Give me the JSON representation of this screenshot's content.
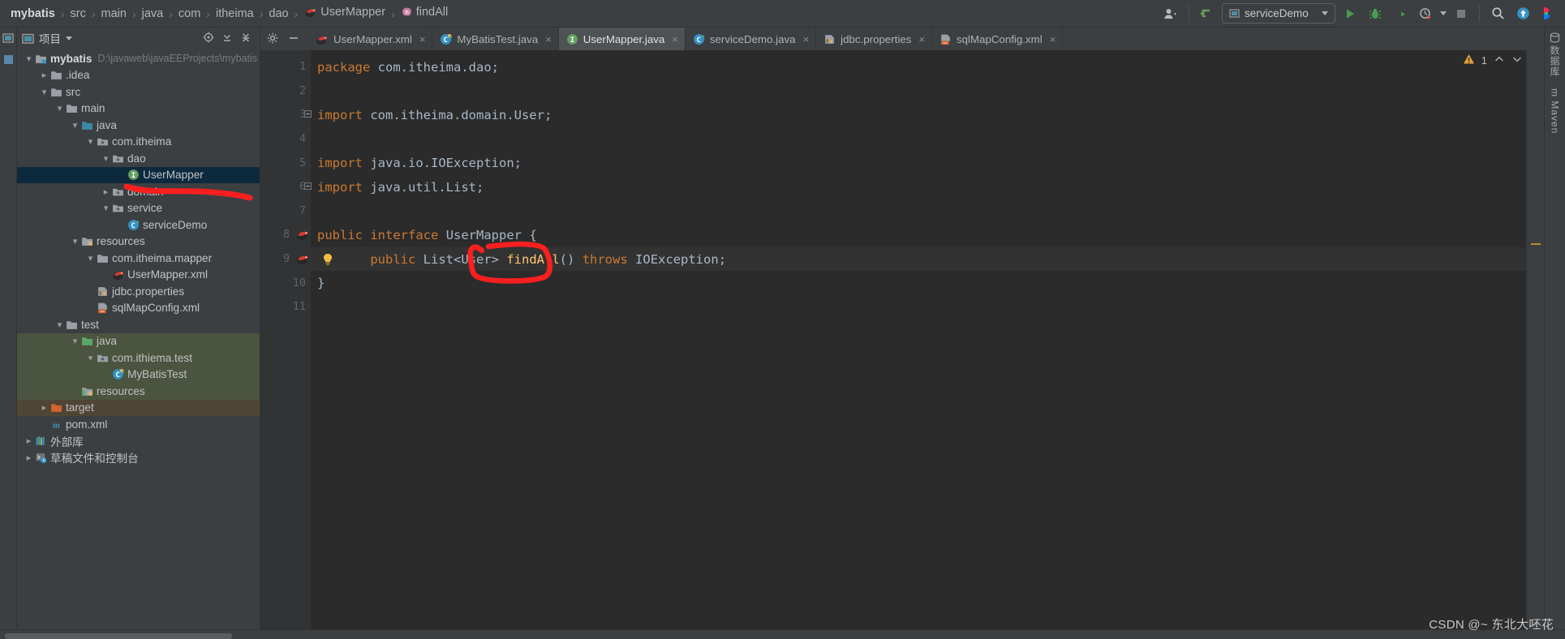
{
  "breadcrumb": {
    "items": [
      {
        "label": "mybatis",
        "icon": "none",
        "bold": true
      },
      {
        "label": "src",
        "icon": "none",
        "bold": false
      },
      {
        "label": "main",
        "icon": "none",
        "bold": false
      },
      {
        "label": "java",
        "icon": "none",
        "bold": false
      },
      {
        "label": "com",
        "icon": "none",
        "bold": false
      },
      {
        "label": "itheima",
        "icon": "none",
        "bold": false
      },
      {
        "label": "dao",
        "icon": "none",
        "bold": false
      },
      {
        "label": "UserMapper",
        "icon": "mybatis-icon",
        "bold": false
      },
      {
        "label": "findAll",
        "icon": "method-icon",
        "bold": false
      }
    ],
    "separator": "›"
  },
  "toolbar": {
    "user_icon": "user-account-icon",
    "update_icon": "update-project-icon",
    "run_config": "serviceDemo",
    "run_label": "run-icon",
    "debug_label": "debug-icon",
    "run_coverage_label": "run-with-coverage-icon",
    "profiler_label": "profiler-icon",
    "stop_label": "stop-icon",
    "search_label": "search-everywhere-icon",
    "updates_label": "updates-icon",
    "ide_label": "ide-icon"
  },
  "project_panel": {
    "title": "项目",
    "header_icons": [
      "locate-icon",
      "expand-all-icon",
      "collapse-all-icon",
      "settings-icon",
      "hide-icon"
    ],
    "tree": [
      {
        "depth": 0,
        "arrow": "open",
        "icon": "module-icon",
        "label": "mybatis",
        "bold": true,
        "path": "D:\\javaweb\\javaEEProjects\\mybatis",
        "state": "normal"
      },
      {
        "depth": 1,
        "arrow": "closed",
        "icon": "folder-icon",
        "label": ".idea",
        "bold": false,
        "path": "",
        "state": "normal"
      },
      {
        "depth": 1,
        "arrow": "open",
        "icon": "folder-icon",
        "label": "src",
        "bold": false,
        "path": "",
        "state": "normal"
      },
      {
        "depth": 2,
        "arrow": "open",
        "icon": "folder-icon",
        "label": "main",
        "bold": false,
        "path": "",
        "state": "normal"
      },
      {
        "depth": 3,
        "arrow": "open",
        "icon": "source-folder-icon",
        "label": "java",
        "bold": false,
        "path": "",
        "state": "normal"
      },
      {
        "depth": 4,
        "arrow": "open",
        "icon": "package-icon",
        "label": "com.itheima",
        "bold": false,
        "path": "",
        "state": "normal"
      },
      {
        "depth": 5,
        "arrow": "open",
        "icon": "package-icon",
        "label": "dao",
        "bold": false,
        "path": "",
        "state": "normal"
      },
      {
        "depth": 6,
        "arrow": "none",
        "icon": "interface-icon",
        "label": "UserMapper",
        "bold": false,
        "path": "",
        "state": "selected"
      },
      {
        "depth": 5,
        "arrow": "closed",
        "icon": "package-icon",
        "label": "domain",
        "bold": false,
        "path": "",
        "state": "normal"
      },
      {
        "depth": 5,
        "arrow": "open",
        "icon": "package-icon",
        "label": "service",
        "bold": false,
        "path": "",
        "state": "normal"
      },
      {
        "depth": 6,
        "arrow": "none",
        "icon": "class-icon",
        "label": "serviceDemo",
        "bold": false,
        "path": "",
        "state": "normal"
      },
      {
        "depth": 3,
        "arrow": "open",
        "icon": "resource-folder-icon",
        "label": "resources",
        "bold": false,
        "path": "",
        "state": "normal"
      },
      {
        "depth": 4,
        "arrow": "open",
        "icon": "folder-icon",
        "label": "com.itheima.mapper",
        "bold": false,
        "path": "",
        "state": "normal"
      },
      {
        "depth": 5,
        "arrow": "none",
        "icon": "mybatis-icon",
        "label": "UserMapper.xml",
        "bold": false,
        "path": "",
        "state": "normal"
      },
      {
        "depth": 4,
        "arrow": "none",
        "icon": "properties-icon",
        "label": "jdbc.properties",
        "bold": false,
        "path": "",
        "state": "normal"
      },
      {
        "depth": 4,
        "arrow": "none",
        "icon": "xml-icon",
        "label": "sqlMapConfig.xml",
        "bold": false,
        "path": "",
        "state": "normal"
      },
      {
        "depth": 2,
        "arrow": "open",
        "icon": "folder-icon",
        "label": "test",
        "bold": false,
        "path": "",
        "state": "normal"
      },
      {
        "depth": 3,
        "arrow": "open",
        "icon": "test-source-folder-icon",
        "label": "java",
        "bold": false,
        "path": "",
        "state": "test"
      },
      {
        "depth": 4,
        "arrow": "open",
        "icon": "package-icon",
        "label": "com.ithiema.test",
        "bold": false,
        "path": "",
        "state": "test"
      },
      {
        "depth": 5,
        "arrow": "none",
        "icon": "test-class-icon",
        "label": "MyBatisTest",
        "bold": false,
        "path": "",
        "state": "test"
      },
      {
        "depth": 3,
        "arrow": "none",
        "icon": "test-resource-folder-icon",
        "label": "resources",
        "bold": false,
        "path": "",
        "state": "test"
      },
      {
        "depth": 1,
        "arrow": "closed",
        "icon": "excluded-folder-icon",
        "label": "target",
        "bold": false,
        "path": "",
        "state": "target"
      },
      {
        "depth": 1,
        "arrow": "none",
        "icon": "maven-icon",
        "label": "pom.xml",
        "bold": false,
        "path": "",
        "state": "normal"
      },
      {
        "depth": 0,
        "arrow": "closed",
        "icon": "external-libraries-icon",
        "label": "外部库",
        "bold": false,
        "path": "",
        "state": "normal"
      },
      {
        "depth": 0,
        "arrow": "closed",
        "icon": "scratches-icon",
        "label": "草稿文件和控制台",
        "bold": false,
        "path": "",
        "state": "normal"
      }
    ]
  },
  "editor_tabs": {
    "tool_icons": [
      "settings-icon",
      "hide-icon"
    ],
    "tabs": [
      {
        "label": "UserMapper.xml",
        "icon": "mybatis-icon",
        "active": false
      },
      {
        "label": "MyBatisTest.java",
        "icon": "test-class-icon",
        "active": false
      },
      {
        "label": "UserMapper.java",
        "icon": "interface-icon",
        "active": true
      },
      {
        "label": "serviceDemo.java",
        "icon": "class-icon",
        "active": false
      },
      {
        "label": "jdbc.properties",
        "icon": "properties-icon",
        "active": false
      },
      {
        "label": "sqlMapConfig.xml",
        "icon": "xml-icon",
        "active": false
      }
    ],
    "close_glyph": "×"
  },
  "editor": {
    "warning_count": "1",
    "warning_icon": "warning-triangle-icon",
    "nav_up": "⌃",
    "nav_down": "⌄",
    "current_line": 9,
    "lines": [
      {
        "num": "1",
        "gutter_icon": "",
        "fold": "",
        "tokens": [
          {
            "t": "package",
            "c": "kw"
          },
          {
            "t": " ",
            "c": "id"
          },
          {
            "t": "com.itheima.dao",
            "c": "id"
          },
          {
            "t": ";",
            "c": "id"
          }
        ]
      },
      {
        "num": "2",
        "gutter_icon": "",
        "fold": "",
        "tokens": []
      },
      {
        "num": "3",
        "gutter_icon": "",
        "fold": "minus",
        "tokens": [
          {
            "t": "import",
            "c": "kw"
          },
          {
            "t": " ",
            "c": "id"
          },
          {
            "t": "com.itheima.domain.User",
            "c": "id"
          },
          {
            "t": ";",
            "c": "id"
          }
        ]
      },
      {
        "num": "4",
        "gutter_icon": "",
        "fold": "",
        "tokens": []
      },
      {
        "num": "5",
        "gutter_icon": "",
        "fold": "",
        "tokens": [
          {
            "t": "import",
            "c": "kw"
          },
          {
            "t": " ",
            "c": "id"
          },
          {
            "t": "java.io.IOException",
            "c": "id"
          },
          {
            "t": ";",
            "c": "id"
          }
        ]
      },
      {
        "num": "6",
        "gutter_icon": "",
        "fold": "minus",
        "tokens": [
          {
            "t": "import",
            "c": "kw"
          },
          {
            "t": " ",
            "c": "id"
          },
          {
            "t": "java.util.List",
            "c": "id"
          },
          {
            "t": ";",
            "c": "id"
          }
        ]
      },
      {
        "num": "7",
        "gutter_icon": "",
        "fold": "",
        "tokens": []
      },
      {
        "num": "8",
        "gutter_icon": "mybatis-gutter-icon",
        "fold": "",
        "tokens": [
          {
            "t": "public",
            "c": "kw"
          },
          {
            "t": " ",
            "c": "id"
          },
          {
            "t": "interface",
            "c": "kw"
          },
          {
            "t": " ",
            "c": "id"
          },
          {
            "t": "UserMapper",
            "c": "ty"
          },
          {
            "t": " {",
            "c": "id"
          }
        ]
      },
      {
        "num": "9",
        "gutter_icon": "mybatis-gutter-icon",
        "fold": "",
        "inline_icon": "intention-bulb-icon",
        "tokens": [
          {
            "t": "    ",
            "c": "id"
          },
          {
            "t": "public",
            "c": "kw"
          },
          {
            "t": " ",
            "c": "id"
          },
          {
            "t": "List<User>",
            "c": "ty"
          },
          {
            "t": " ",
            "c": "id"
          },
          {
            "t": "findAll",
            "c": "mth"
          },
          {
            "t": "()",
            "c": "id"
          },
          {
            "t": " ",
            "c": "id"
          },
          {
            "t": "throws",
            "c": "kw"
          },
          {
            "t": " ",
            "c": "id"
          },
          {
            "t": "IOException",
            "c": "ty"
          },
          {
            "t": ";",
            "c": "id"
          }
        ]
      },
      {
        "num": "10",
        "gutter_icon": "",
        "fold": "",
        "tokens": [
          {
            "t": "}",
            "c": "id"
          }
        ]
      },
      {
        "num": "11",
        "gutter_icon": "",
        "fold": "",
        "tokens": []
      }
    ]
  },
  "right_strip": {
    "items": [
      "数据库",
      "m Maven"
    ]
  },
  "annotations": {
    "color": "#fb1f1f",
    "underline_target": "UserMapper tree node",
    "circle_target": "findAll() method name"
  },
  "watermark": "CSDN @~ 东北大呸花",
  "colors": {
    "bg": "#3c3f41",
    "editor_bg": "#2b2b2b",
    "gutter_bg": "#313335",
    "selection": "#0d293e",
    "keyword": "#cc7832",
    "method": "#ffc66d",
    "identifier": "#a9b7c6",
    "annotation_red": "#fb1f1f",
    "test_src": "#4b543f",
    "target_row": "#4f4535"
  }
}
